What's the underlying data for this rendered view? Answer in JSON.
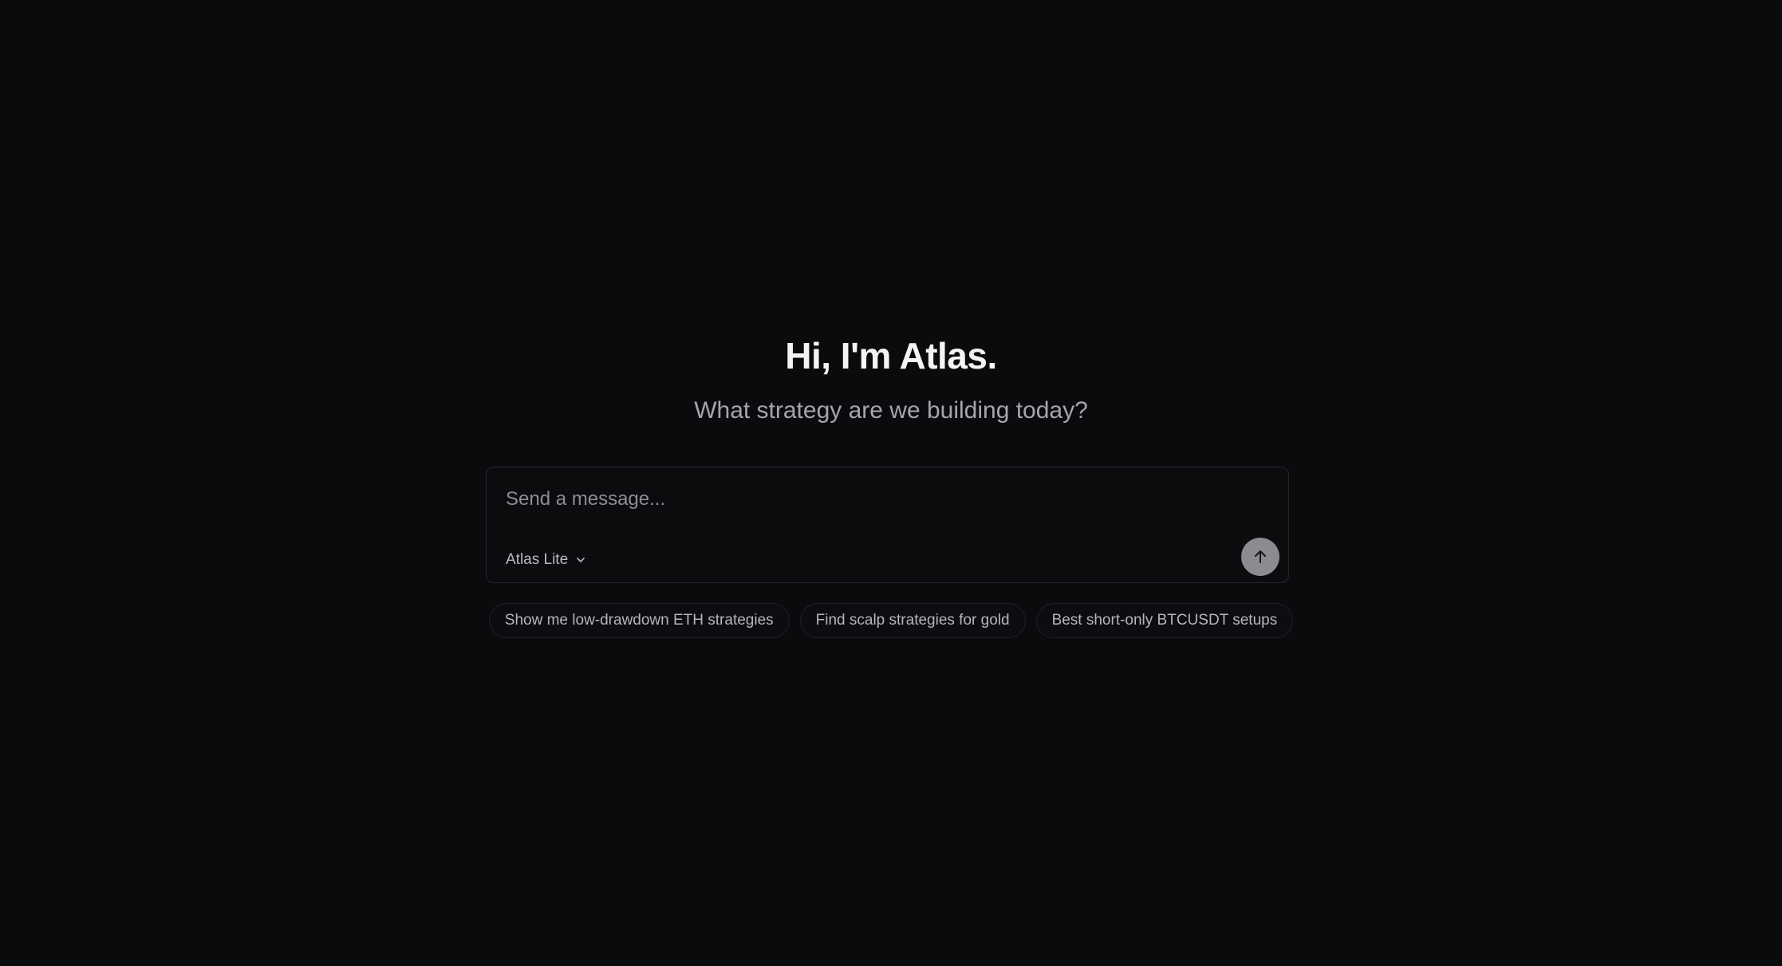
{
  "hero": {
    "greeting": "Hi, I'm Atlas.",
    "subtitle": "What strategy are we building today?"
  },
  "composer": {
    "placeholder": "Send a message...",
    "value": "",
    "model_label": "Atlas Lite",
    "model_icon": "chevron-down-icon",
    "send_icon": "arrow-up-icon"
  },
  "suggestions": [
    "Show me low-drawdown ETH strategies",
    "Find scalp strategies for gold",
    "Best short-only BTCUSDT setups"
  ],
  "colors": {
    "background": "#0a0b0d",
    "send_button": "#8b8c8f",
    "heading": "#f4f4f5",
    "muted_text": "#a4a6ab"
  }
}
